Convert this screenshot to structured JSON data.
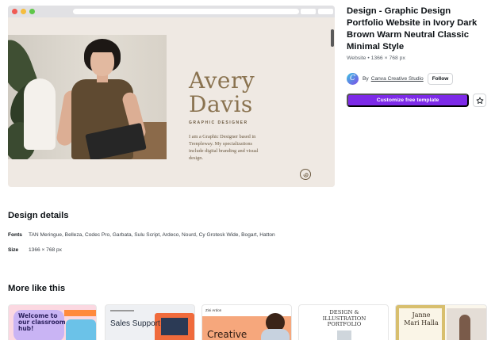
{
  "template": {
    "title": "Design - Graphic Design Portfolio Website in Ivory Dark Brown Warm Neutral Classic Minimal Style",
    "meta": "Website • 1366 × 768 px",
    "by_label": "By",
    "creator_name": "Canva Creative Studio",
    "creator_initial": "C",
    "follow_label": "Follow",
    "customize_label": "Customize free template"
  },
  "preview": {
    "name_line1": "Avery",
    "name_line2": "Davis",
    "role": "GRAPHIC DESIGNER",
    "bio": "I am a Graphic Designer based in Trenpleway. My specializations include digital branding and visual design."
  },
  "details": {
    "heading": "Design details",
    "fonts_label": "Fonts",
    "fonts_value": "TAN Meringue, Belleza, Codec Pro, Garbata, Sulu Script, Ardeco, Nourd, Cy Grotesk Wide, Bogart, Hatton",
    "size_label": "Size",
    "size_value": "1366 × 768 px"
  },
  "more": {
    "heading": "More like this",
    "cards": [
      {
        "text": "Welcome to our classroom hub!"
      },
      {
        "text": "Sales Support"
      },
      {
        "text": "Creative",
        "small": "Zini Ardon"
      },
      {
        "text": "DESIGN & ILLUSTRATION PORTFOLIO"
      },
      {
        "text": "Janne Mari Halla"
      }
    ]
  },
  "colors": {
    "accent": "#7d2ae8",
    "preview_bg": "#efe9e3",
    "preview_text": "#8a7350"
  },
  "icons": {
    "star": "star-outline-icon",
    "logo": "spiral-logo-icon"
  }
}
